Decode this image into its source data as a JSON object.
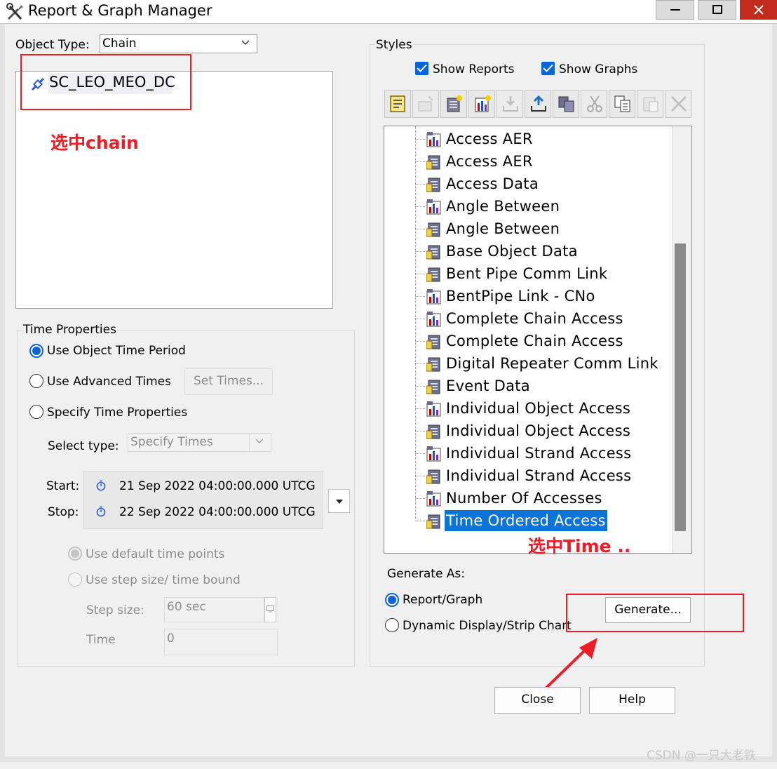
{
  "window": {
    "title": "Report & Graph Manager"
  },
  "object_type": {
    "label": "Object Type:",
    "value": "Chain"
  },
  "objects": [
    {
      "name": "SC_LEO_MEO_DC"
    }
  ],
  "annotations": {
    "select_chain": "选中chain",
    "select_time": "选中Time ..",
    "accent_color": "#ee1c25"
  },
  "time_properties": {
    "title": "Time Properties",
    "use_object_time_period": "Use Object Time Period",
    "use_advanced_times": "Use Advanced Times",
    "set_times_button": "Set Times...",
    "specify_time_properties": "Specify Time Properties",
    "select_type_label": "Select type:",
    "select_type_value": "Specify Times",
    "start_label": "Start:",
    "start_value": "21 Sep 2022 04:00:00.000 UTCG",
    "stop_label": "Stop:",
    "stop_value": "22 Sep 2022 04:00:00.000 UTCG",
    "use_default_time_points": "Use default time points",
    "use_step_size": "Use step size/ time bound",
    "step_size_label": "Step size:",
    "step_size_value": "60 sec",
    "time_label": "Time",
    "time_value": "0"
  },
  "styles": {
    "title": "Styles",
    "show_reports": "Show Reports",
    "show_graphs": "Show Graphs",
    "items": [
      {
        "label": "Access AER",
        "kind": "graph"
      },
      {
        "label": "Access AER",
        "kind": "report"
      },
      {
        "label": "Access Data",
        "kind": "report"
      },
      {
        "label": "Angle Between",
        "kind": "graph"
      },
      {
        "label": "Angle Between",
        "kind": "report"
      },
      {
        "label": "Base Object Data",
        "kind": "report"
      },
      {
        "label": "Bent Pipe Comm Link",
        "kind": "report"
      },
      {
        "label": "BentPipe Link - CNo",
        "kind": "graph"
      },
      {
        "label": "Complete Chain Access",
        "kind": "graph"
      },
      {
        "label": "Complete Chain Access",
        "kind": "report"
      },
      {
        "label": "Digital Repeater Comm Link",
        "kind": "report"
      },
      {
        "label": "Event Data",
        "kind": "report"
      },
      {
        "label": "Individual Object Access",
        "kind": "graph"
      },
      {
        "label": "Individual Object Access",
        "kind": "report"
      },
      {
        "label": "Individual Strand Access",
        "kind": "graph"
      },
      {
        "label": "Individual Strand Access",
        "kind": "report"
      },
      {
        "label": "Number Of Accesses",
        "kind": "graph"
      },
      {
        "label": "Time Ordered Access",
        "kind": "report",
        "selected": true
      }
    ]
  },
  "generate_as": {
    "title": "Generate As:",
    "report_graph": "Report/Graph",
    "dynamic_display": "Dynamic Display/Strip Chart",
    "generate_button": "Generate..."
  },
  "footer": {
    "close": "Close",
    "help": "Help"
  },
  "watermark": "CSDN @一只大老铁"
}
